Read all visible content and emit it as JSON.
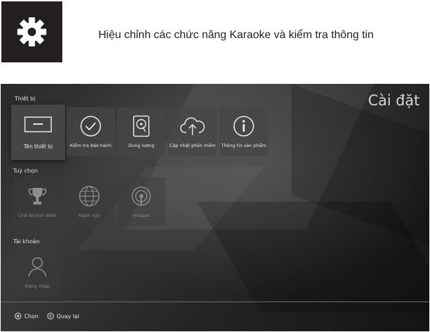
{
  "header": {
    "gear_icon": "gear-icon",
    "description": "Hiệu chỉnh các chức năng Karaoke và kiểm tra thông tin"
  },
  "screen": {
    "title": "Cài đặt",
    "sections": {
      "device": {
        "label": "Thiết bị",
        "tiles": [
          {
            "label": "Tên thiết bị",
            "icon": "tv-icon",
            "state": "selected"
          },
          {
            "label": "Kiểm tra bảo hành",
            "icon": "check-circle-icon",
            "state": "normal"
          },
          {
            "label": "Dung lượng",
            "icon": "hard-drive-icon",
            "state": "normal"
          },
          {
            "label": "Cập nhật phần mềm",
            "icon": "cloud-upload-icon",
            "state": "normal"
          },
          {
            "label": "Thông tin sản phẩm",
            "icon": "info-icon",
            "state": "normal"
          }
        ]
      },
      "options": {
        "label": "Tuỳ chọn",
        "tiles": [
          {
            "label": "Chế độ tính điểm",
            "icon": "trophy-icon",
            "state": "disabled"
          },
          {
            "label": "Ngôn ngữ",
            "icon": "globe-icon",
            "state": "disabled"
          },
          {
            "label": "Hotspot",
            "icon": "hotspot-icon",
            "state": "disabled"
          }
        ]
      },
      "account": {
        "label": "Tài khoản",
        "tiles": [
          {
            "label": "Đăng nhập",
            "icon": "user-icon",
            "state": "disabled"
          }
        ]
      }
    },
    "footer": {
      "select_label": "Chọn",
      "back_label": "Quay lại"
    }
  },
  "colors": {
    "background": "#1c1c1c",
    "tile": "#464646",
    "text": "#e0e0e0",
    "dim_text": "#8a8a8a"
  }
}
